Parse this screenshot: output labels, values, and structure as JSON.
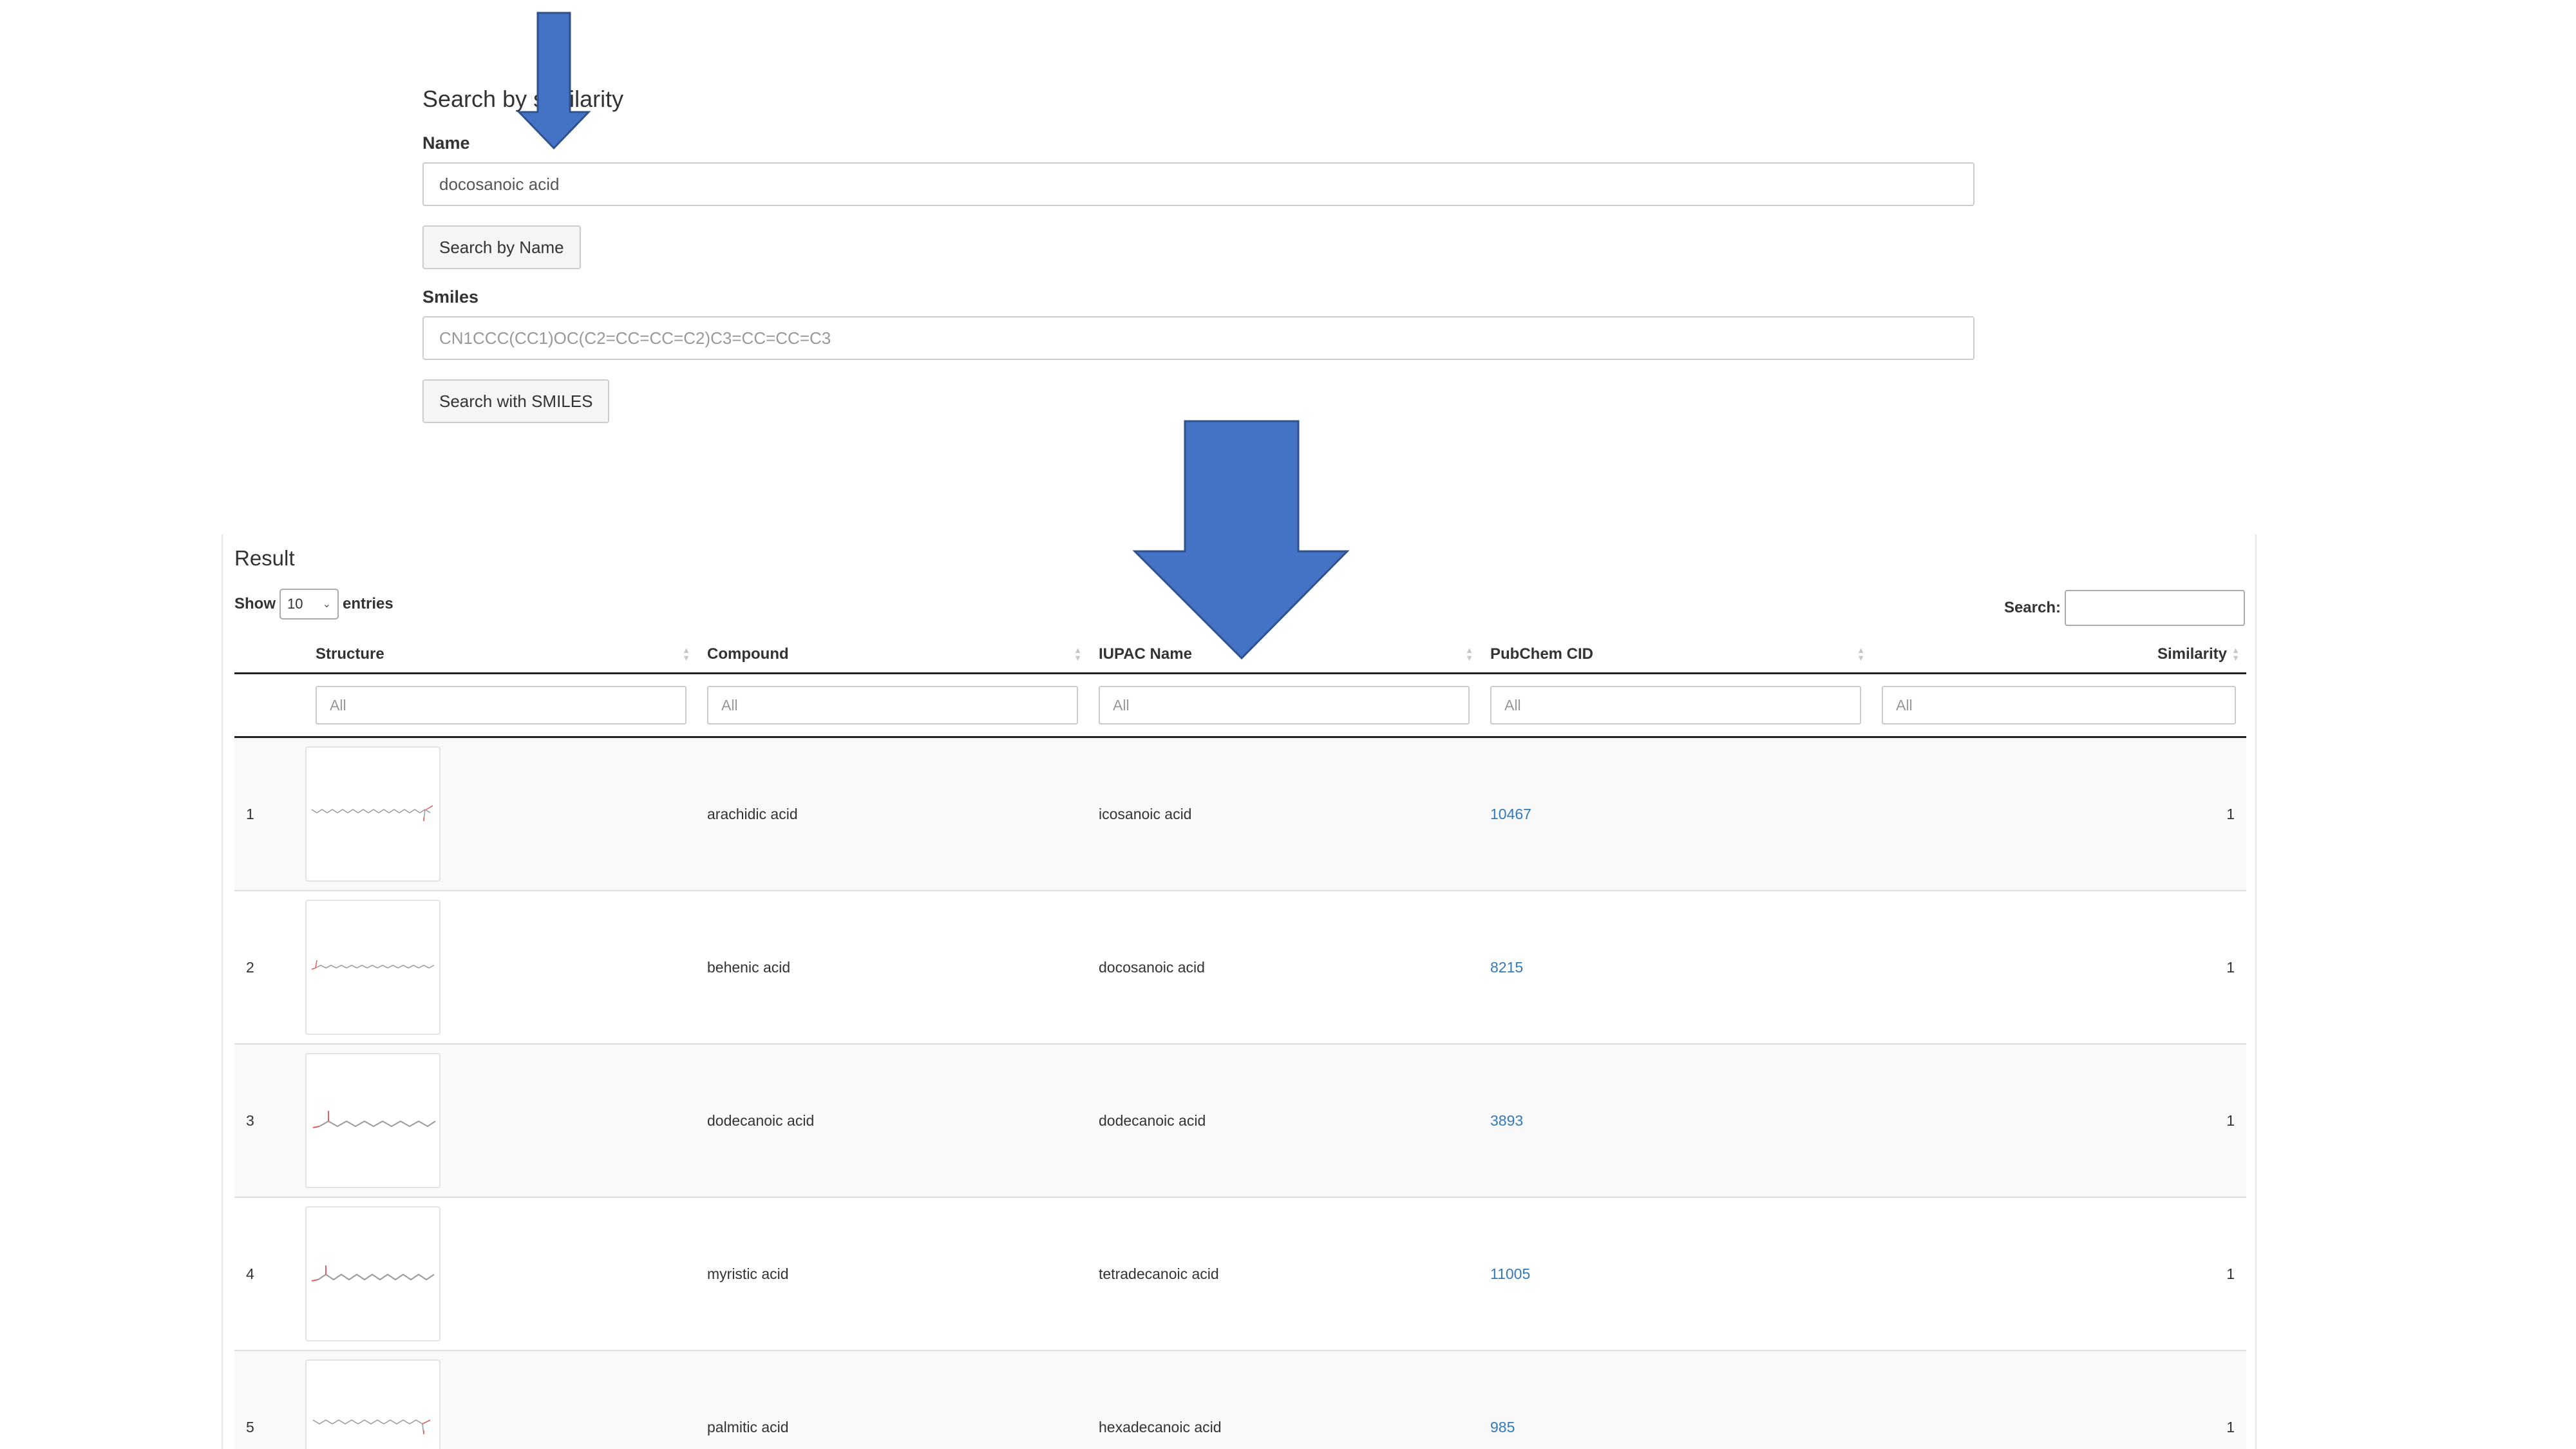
{
  "search": {
    "title": "Search by similarity",
    "name_label": "Name",
    "name_value": "docosanoic acid",
    "name_button": "Search by Name",
    "smiles_label": "Smiles",
    "smiles_placeholder": "CN1CCC(CC1)OC(C2=CC=CC=C2)C3=CC=CC=C3",
    "smiles_button": "Search with SMILES"
  },
  "result": {
    "title": "Result",
    "show_label": "Show",
    "entries_value": "10",
    "entries_label": "entries",
    "search_label": "Search:",
    "columns": [
      "Structure",
      "Compound",
      "IUPAC Name",
      "PubChem CID",
      "Similarity"
    ],
    "filter_placeholder": "All",
    "rows": [
      {
        "index": "1",
        "compound": "arachidic acid",
        "iupac": "icosanoic acid",
        "cid": "10467",
        "similarity": "1"
      },
      {
        "index": "2",
        "compound": "behenic acid",
        "iupac": "docosanoic acid",
        "cid": "8215",
        "similarity": "1"
      },
      {
        "index": "3",
        "compound": "dodecanoic acid",
        "iupac": "dodecanoic acid",
        "cid": "3893",
        "similarity": "1"
      },
      {
        "index": "4",
        "compound": "myristic acid",
        "iupac": "tetradecanoic acid",
        "cid": "11005",
        "similarity": "1"
      },
      {
        "index": "5",
        "compound": "palmitic acid",
        "iupac": "hexadecanoic acid",
        "cid": "985",
        "similarity": "1"
      }
    ]
  },
  "colors": {
    "arrow_fill": "#4472c4",
    "arrow_stroke": "#2f528f",
    "link": "#337ab7",
    "molecule_bond": "#9a9a9a",
    "molecule_oxygen": "#e06060"
  }
}
